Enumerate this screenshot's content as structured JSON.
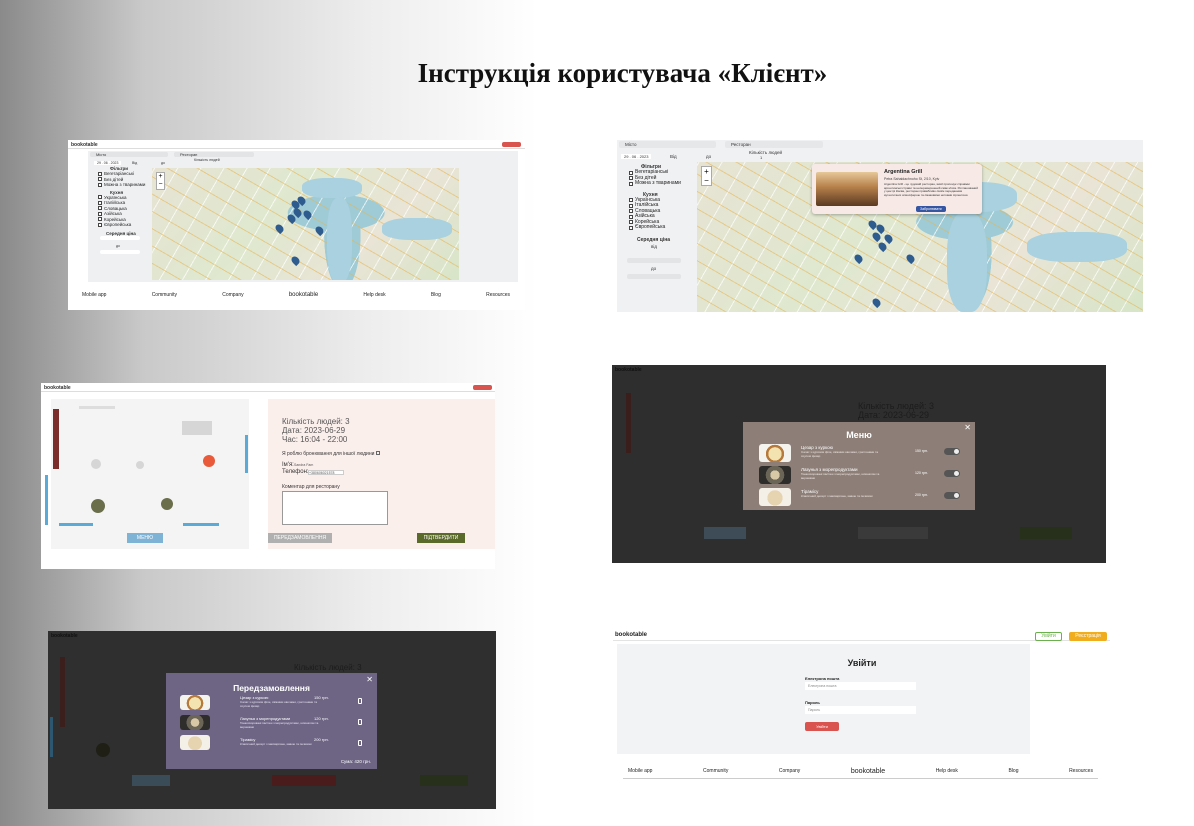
{
  "page_title": "Інструкція користувача «Клієнт»",
  "brand": "bookotable",
  "shot1": {
    "search_city": "Місто",
    "search_restaurant": "Ресторан",
    "date": "29 . 06 . 2023",
    "from_label": "Від",
    "to_label": "до",
    "people_label": "Кількість людей",
    "people_value": "1",
    "filters_title": "Фільтри",
    "filters": [
      "Вегетаріанські",
      "Без дітей",
      "Можна з тваринами"
    ],
    "cuisine_title": "Кухня",
    "cuisines": [
      "Українська",
      "Італійська",
      "Словацька",
      "Азійська",
      "Корейська",
      "Європейська"
    ],
    "price_title": "Середня ціна",
    "price_from": "від",
    "price_to": "до",
    "footer": [
      "Mobile app",
      "Community",
      "Company",
      "bookotable",
      "Help desk",
      "Blog",
      "Resources"
    ]
  },
  "shot2": {
    "popup_name": "Argentina Grill",
    "popup_address": "Petra Sahaidachnoho St, 2/10, Kyiv",
    "popup_desc": "Argentina Grill - це чудовий ресторан, який пропонує справжні аргентинські страви та неперевершений смак м'яса. Розташований у центрі Києва, ресторан привабливо своїм переданням аутентичних атмосферою та смаковими нотками Аргентини.",
    "popup_button": "Забронювати"
  },
  "shot3": {
    "people": "Кількість людей: 3",
    "date": "Дата: 2023-06-29",
    "time": "Час: 16:04 - 22:00",
    "other_person": "Я роблю бронювання для іншої людини",
    "name_label": "Ім'я:",
    "name_value": "Sandra Fam",
    "phone_label": "Телефон:",
    "phone_value": "+380606021578",
    "comment_label": "Коментар для ресторану",
    "menu_button": "МЕНЮ",
    "preorder_button": "ПЕРЕДЗАМОВЛЕННЯ",
    "confirm_button": "ПІДТВЕРДИТИ"
  },
  "shot4": {
    "modal_title": "Меню",
    "close": "✕",
    "items": [
      {
        "name": "Цезар з куркою",
        "desc": "Салат з курячим філе, свіжими овочами, грагтонами та соусом Цезар",
        "price": "150 грн."
      },
      {
        "name": "Лазунья з морепродуктами",
        "desc": "Тонкоскоровані пасташ з морепродуктами, шпинатом та вершками",
        "price": "120 грн."
      },
      {
        "name": "Тірамісу",
        "desc": "Класичний десерт з маскарпоне, кавою та печивом",
        "price": "200 грн."
      }
    ],
    "bg_people": "Кількість людей: 3",
    "bg_date": "Дата: 2023-06-29"
  },
  "shot5": {
    "modal_title": "Передзамовлення",
    "close": "✕",
    "items": [
      {
        "name": "Цезар з куркою",
        "desc": "Салат з курячим філе, свіжими овочами, грагтонами та соусом Цезар",
        "price": "150 грн."
      },
      {
        "name": "Лазунья з морепродуктами",
        "desc": "Тонкоскоровані пасташ з морепродуктами, шпинатом та вершками",
        "price": "120 грн."
      },
      {
        "name": "Тірамісу",
        "desc": "Класичний десерт з маскарпоне, кавою та печивом",
        "price": "200 грн."
      }
    ],
    "total": "Сума: 420 грн.",
    "bg_people": "Кількість людей: 3"
  },
  "shot6": {
    "login_button": "Увійти",
    "register_button": "Реєстрація",
    "heading": "Увійти",
    "email_label": "Електрона пошта",
    "email_placeholder": "Електрона пошта",
    "password_label": "Пароль",
    "password_placeholder": "Пароль",
    "submit": "Увійти",
    "footer": [
      "Mobile app",
      "Community",
      "Company",
      "bookotable",
      "Help desk",
      "Blog",
      "Resources"
    ]
  },
  "colors": {
    "accent_red": "#d9534f",
    "confirm_green": "#5a6a2a",
    "menu_blue": "#7fb3d5",
    "orange": "#f0ad1e",
    "modal_brown": "#8d7f78",
    "modal_purple": "#6e6585"
  }
}
